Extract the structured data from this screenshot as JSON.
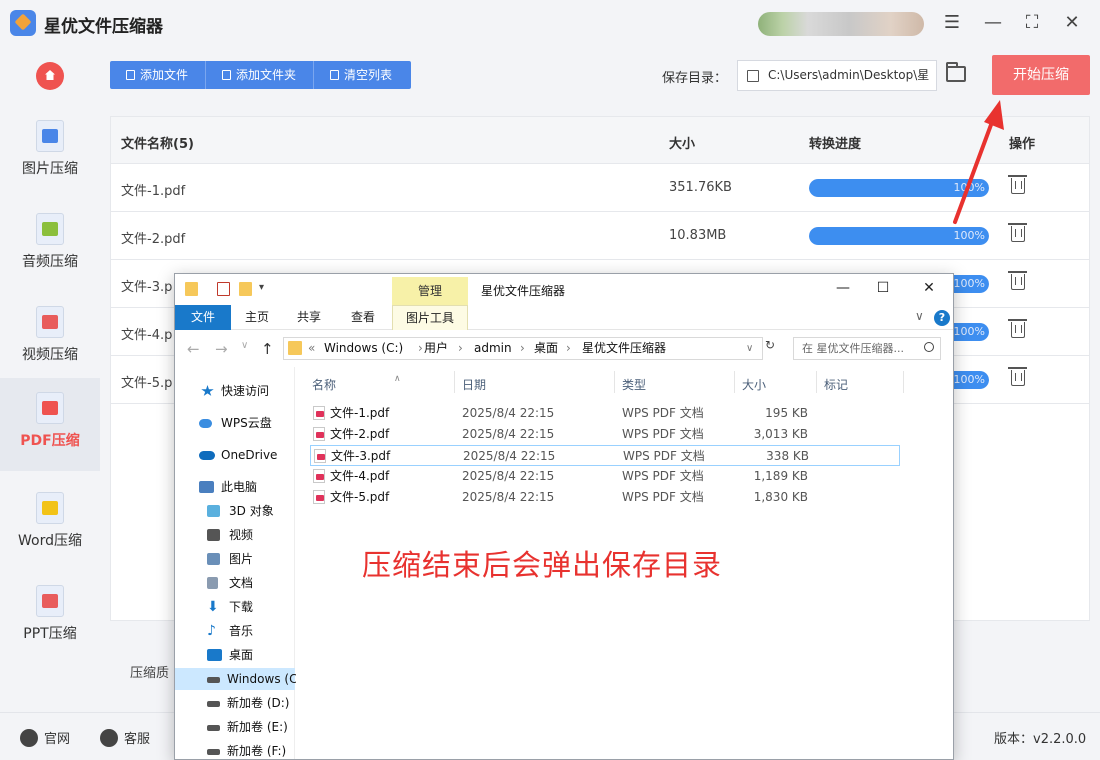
{
  "app": {
    "title": "星优文件压缩器",
    "window_controls": [
      "☰",
      "—",
      "⛶",
      "✕"
    ]
  },
  "sidebar": {
    "items": [
      {
        "label": "图片压缩",
        "icon": "image-icon",
        "color": "#4a86e8"
      },
      {
        "label": "音频压缩",
        "icon": "audio-icon",
        "color": "#8bbf3c"
      },
      {
        "label": "视频压缩",
        "icon": "video-icon",
        "color": "#e85c5c"
      },
      {
        "label": "PDF压缩",
        "icon": "pdf-icon",
        "color": "#ef5350",
        "active": true
      },
      {
        "label": "Word压缩",
        "icon": "word-icon",
        "color": "#f2c318"
      },
      {
        "label": "PPT压缩",
        "icon": "ppt-icon",
        "color": "#e85c5c"
      }
    ]
  },
  "toolbar": {
    "add_file": "添加文件",
    "add_folder": "添加文件夹",
    "clear_list": "清空列表",
    "save_dir_label": "保存目录：",
    "save_dir_value": "C:\\Users\\admin\\Desktop\\星",
    "start_button": "开始压缩"
  },
  "table": {
    "headers": {
      "name": "文件名称(5)",
      "size": "大小",
      "progress": "转换进度",
      "action": "操作"
    },
    "rows": [
      {
        "name": "文件-1.pdf",
        "size": "351.76KB",
        "progress": "100%",
        "progress_value": 1.0
      },
      {
        "name": "文件-2.pdf",
        "size": "10.83MB",
        "progress": "100%",
        "progress_value": 1.0
      },
      {
        "name": "文件-3.p",
        "size": "",
        "progress": "100%",
        "progress_value": 1.0
      },
      {
        "name": "文件-4.p",
        "size": "",
        "progress": "100%",
        "progress_value": 1.0
      },
      {
        "name": "文件-5.p",
        "size": "",
        "progress": "100%",
        "progress_value": 1.0
      }
    ]
  },
  "bottom": {
    "quality_label": "压缩质"
  },
  "footer": {
    "website": "官网",
    "support": "客服",
    "version": "版本：v2.2.0.0"
  },
  "explorer": {
    "manage_tab": "管理",
    "title": "星优文件压缩器",
    "ribbon_tabs": [
      "文件",
      "主页",
      "共享",
      "查看",
      "图片工具"
    ],
    "address": [
      "Windows (C:)",
      "用户",
      "admin",
      "桌面",
      "星优文件压缩器"
    ],
    "search_placeholder": "在 星优文件压缩器...",
    "nav": [
      {
        "label": "快速访问",
        "icon": "star-icon",
        "color": "#1979ca"
      },
      {
        "label": "WPS云盘",
        "icon": "cloud-icon",
        "color": "#3a8de0"
      },
      {
        "label": "OneDrive",
        "icon": "onedrive-icon",
        "color": "#0f6cbd"
      },
      {
        "label": "此电脑",
        "icon": "computer-icon",
        "color": "#4a7fbf"
      },
      {
        "label": "3D 对象",
        "icon": "cube-icon",
        "color": "#5ab0de"
      },
      {
        "label": "视频",
        "icon": "film-icon",
        "color": "#555555"
      },
      {
        "label": "图片",
        "icon": "picture-icon",
        "color": "#6a8fb8"
      },
      {
        "label": "文档",
        "icon": "document-icon",
        "color": "#8a9bb0"
      },
      {
        "label": "下载",
        "icon": "download-icon",
        "color": "#1979ca"
      },
      {
        "label": "音乐",
        "icon": "music-icon",
        "color": "#1979ca"
      },
      {
        "label": "桌面",
        "icon": "desktop-icon",
        "color": "#1979ca"
      },
      {
        "label": "Windows (C",
        "icon": "drive-icon",
        "color": "#555555",
        "selected": true
      },
      {
        "label": "新加卷 (D:)",
        "icon": "drive-icon",
        "color": "#555555"
      },
      {
        "label": "新加卷 (E:)",
        "icon": "drive-icon",
        "color": "#555555"
      },
      {
        "label": "新加卷 (F:)",
        "icon": "drive-icon",
        "color": "#555555"
      }
    ],
    "columns": {
      "name": "名称",
      "date": "日期",
      "type": "类型",
      "size": "大小",
      "tags": "标记"
    },
    "files": [
      {
        "name": "文件-1.pdf",
        "date": "2025/8/4 22:15",
        "type": "WPS PDF 文档",
        "size": "195 KB"
      },
      {
        "name": "文件-2.pdf",
        "date": "2025/8/4 22:15",
        "type": "WPS PDF 文档",
        "size": "3,013 KB"
      },
      {
        "name": "文件-3.pdf",
        "date": "2025/8/4 22:15",
        "type": "WPS PDF 文档",
        "size": "338 KB",
        "selected": true
      },
      {
        "name": "文件-4.pdf",
        "date": "2025/8/4 22:15",
        "type": "WPS PDF 文档",
        "size": "1,189 KB"
      },
      {
        "name": "文件-5.pdf",
        "date": "2025/8/4 22:15",
        "type": "WPS PDF 文档",
        "size": "1,830 KB"
      }
    ]
  },
  "annotation": "压缩结束后会弹出保存目录",
  "colors": {
    "accent": "#4a86e8",
    "start": "#f26b6b",
    "active": "#ef5350",
    "progress": "#3d8ef0",
    "annotation": "#e8322f"
  }
}
